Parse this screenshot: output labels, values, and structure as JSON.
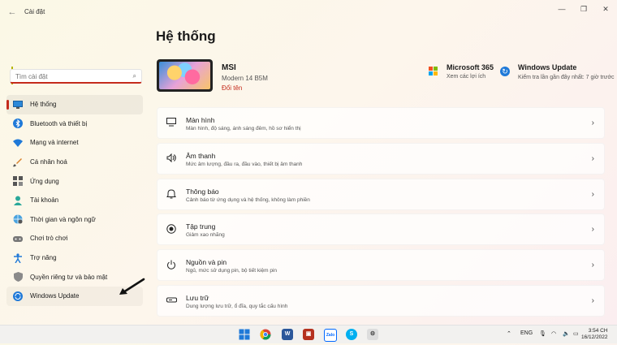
{
  "window": {
    "title": "Cài đặt"
  },
  "search": {
    "placeholder": "Tìm cài đặt"
  },
  "sidebar": {
    "items": [
      {
        "label": "Hệ thống",
        "icon": "display-icon"
      },
      {
        "label": "Bluetooth và thiết bị",
        "icon": "bluetooth-icon"
      },
      {
        "label": "Mạng và internet",
        "icon": "wifi-icon"
      },
      {
        "label": "Cá nhân hoá",
        "icon": "brush-icon"
      },
      {
        "label": "Ứng dụng",
        "icon": "apps-icon"
      },
      {
        "label": "Tài khoản",
        "icon": "person-icon"
      },
      {
        "label": "Thời gian và ngôn ngữ",
        "icon": "globe-icon"
      },
      {
        "label": "Chơi trò chơi",
        "icon": "gamepad-icon"
      },
      {
        "label": "Trợ năng",
        "icon": "accessibility-icon"
      },
      {
        "label": "Quyền riêng tư và bảo mật",
        "icon": "shield-icon"
      },
      {
        "label": "Windows Update",
        "icon": "update-icon"
      }
    ]
  },
  "main": {
    "title": "Hệ thống",
    "device": {
      "name": "MSI",
      "model": "Modern 14 B5M",
      "rename": "Đổi tên"
    },
    "ms365": {
      "title": "Microsoft 365",
      "subtitle": "Xem các lợi ích"
    },
    "update": {
      "title": "Windows Update",
      "subtitle": "Kiểm tra lần gần đây nhất: 7 giờ trước"
    },
    "cards": [
      {
        "title": "Màn hình",
        "subtitle": "Màn hình, độ sáng, ánh sáng đêm, hồ sơ hiển thị",
        "icon": "monitor-icon"
      },
      {
        "title": "Âm thanh",
        "subtitle": "Mức âm lượng, đầu ra, đầu vào, thiết bị âm thanh",
        "icon": "speaker-icon"
      },
      {
        "title": "Thông báo",
        "subtitle": "Cảnh báo từ ứng dụng và hệ thống, không làm phiền",
        "icon": "bell-icon"
      },
      {
        "title": "Tập trung",
        "subtitle": "Giảm xao nhãng",
        "icon": "focus-icon"
      },
      {
        "title": "Nguồn và pin",
        "subtitle": "Ngủ, mức sử dụng pin, bộ tiết kiệm pin",
        "icon": "power-icon"
      },
      {
        "title": "Lưu trữ",
        "subtitle": "Dung lượng lưu trữ, ổ đĩa, quy tắc cấu hình",
        "icon": "storage-icon"
      }
    ]
  },
  "taskbar": {
    "lang": "ENG",
    "time": "3:54 CH",
    "date": "16/12/2022"
  },
  "colors": {
    "accent": "#c42b1c",
    "update_blue": "#1f79d8"
  }
}
